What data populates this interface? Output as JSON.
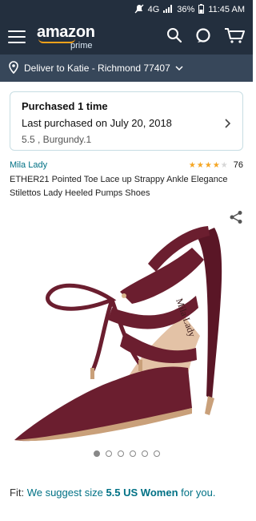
{
  "status_bar": {
    "network": "4G",
    "battery": "36%",
    "time": "11:45 AM"
  },
  "header": {
    "logo_word": "amazon",
    "logo_sub": "prime"
  },
  "deliver": {
    "text": "Deliver to Katie - Richmond 77407"
  },
  "purchase_card": {
    "title": "Purchased 1 time",
    "last_purchased": "Last purchased on July 20, 2018",
    "variant": "5.5 , Burgundy.1"
  },
  "product": {
    "brand": "Mila Lady",
    "rating": 4,
    "rating_max": 5,
    "review_count": "76",
    "title": "ETHER21 Pointed Toe Lace up Strappy Ankle Elegance Stilettos Lady Heeled Pumps Shoes",
    "image_count": 6,
    "active_image": 1
  },
  "fit": {
    "prefix": "Fit:",
    "text1": "We suggest size",
    "size": "5.5 US Women",
    "text2": "for you."
  },
  "colors": {
    "header_bg": "#232f3e",
    "deliver_bg": "#37475a",
    "link": "#007185",
    "star": "#f5a623",
    "shoe": "#6b1e2f"
  }
}
